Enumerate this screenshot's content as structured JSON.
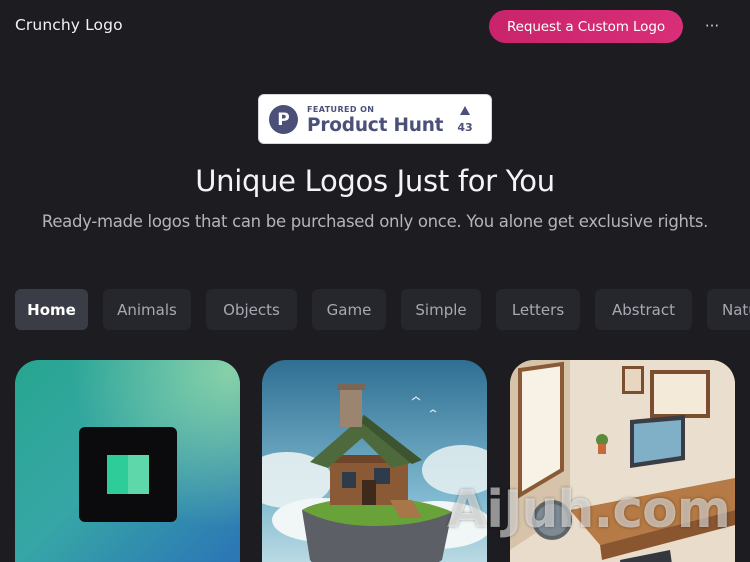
{
  "header": {
    "brand": "Crunchy Logo",
    "cta_label": "Request a Custom Logo",
    "more_icon": "···"
  },
  "product_hunt": {
    "featured_label": "FEATURED ON",
    "name": "Product Hunt",
    "logo_letter": "P",
    "upvotes": "43"
  },
  "hero": {
    "title": "Unique Logos Just for You",
    "subtitle": "Ready-made logos that can be purchased only once. You alone get exclusive rights."
  },
  "categories": [
    {
      "label": "Home",
      "active": true
    },
    {
      "label": "Animals",
      "active": false
    },
    {
      "label": "Objects",
      "active": false
    },
    {
      "label": "Game",
      "active": false
    },
    {
      "label": "Simple",
      "active": false
    },
    {
      "label": "Letters",
      "active": false
    },
    {
      "label": "Abstract",
      "active": false
    },
    {
      "label": "Nature",
      "active": false
    }
  ],
  "cards": [
    {
      "name": "gradient-square-logo"
    },
    {
      "name": "cottage-island-logo"
    },
    {
      "name": "isometric-office-logo"
    }
  ],
  "watermark": "AiJuh.com",
  "colors": {
    "background": "#1c1c21",
    "accent": "#d12a72",
    "tab_bg": "#26272d",
    "tab_active_bg": "#3a3d45",
    "product_hunt": "#4a5078"
  }
}
